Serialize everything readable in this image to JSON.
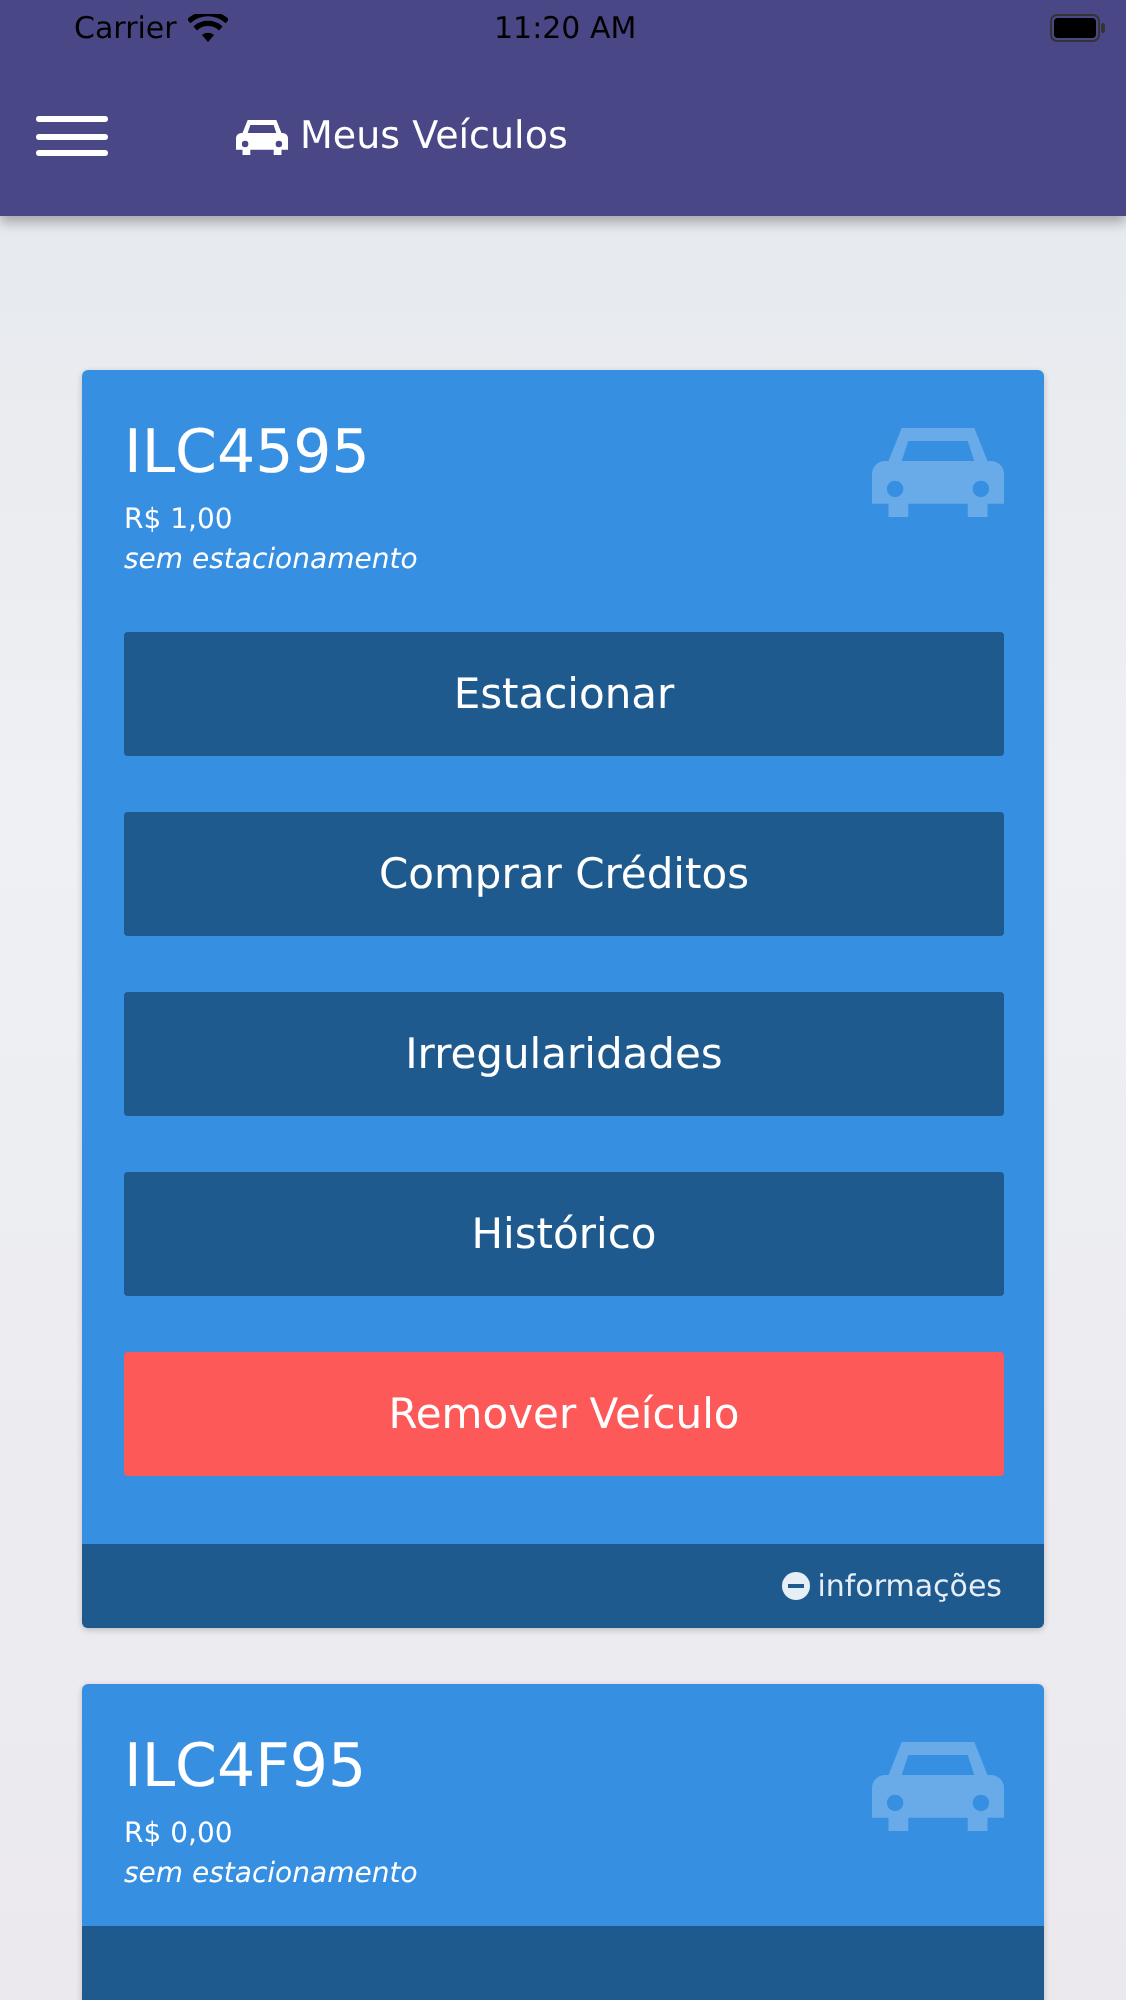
{
  "status_bar": {
    "carrier": "Carrier",
    "time": "11:20 AM"
  },
  "header": {
    "title": "Meus Veículos"
  },
  "vehicles": [
    {
      "plate": "ILC4595",
      "balance": "R$ 1,00",
      "status": "sem estacionamento",
      "expanded": true,
      "actions": [
        {
          "label": "Estacionar",
          "kind": "primary"
        },
        {
          "label": "Comprar Créditos",
          "kind": "primary"
        },
        {
          "label": "Irregularidades",
          "kind": "primary"
        },
        {
          "label": "Histórico",
          "kind": "primary"
        },
        {
          "label": "Remover Veículo",
          "kind": "danger"
        }
      ],
      "footer_label": "informações"
    },
    {
      "plate": "ILC4F95",
      "balance": "R$ 0,00",
      "status": "sem estacionamento"
    }
  ]
}
